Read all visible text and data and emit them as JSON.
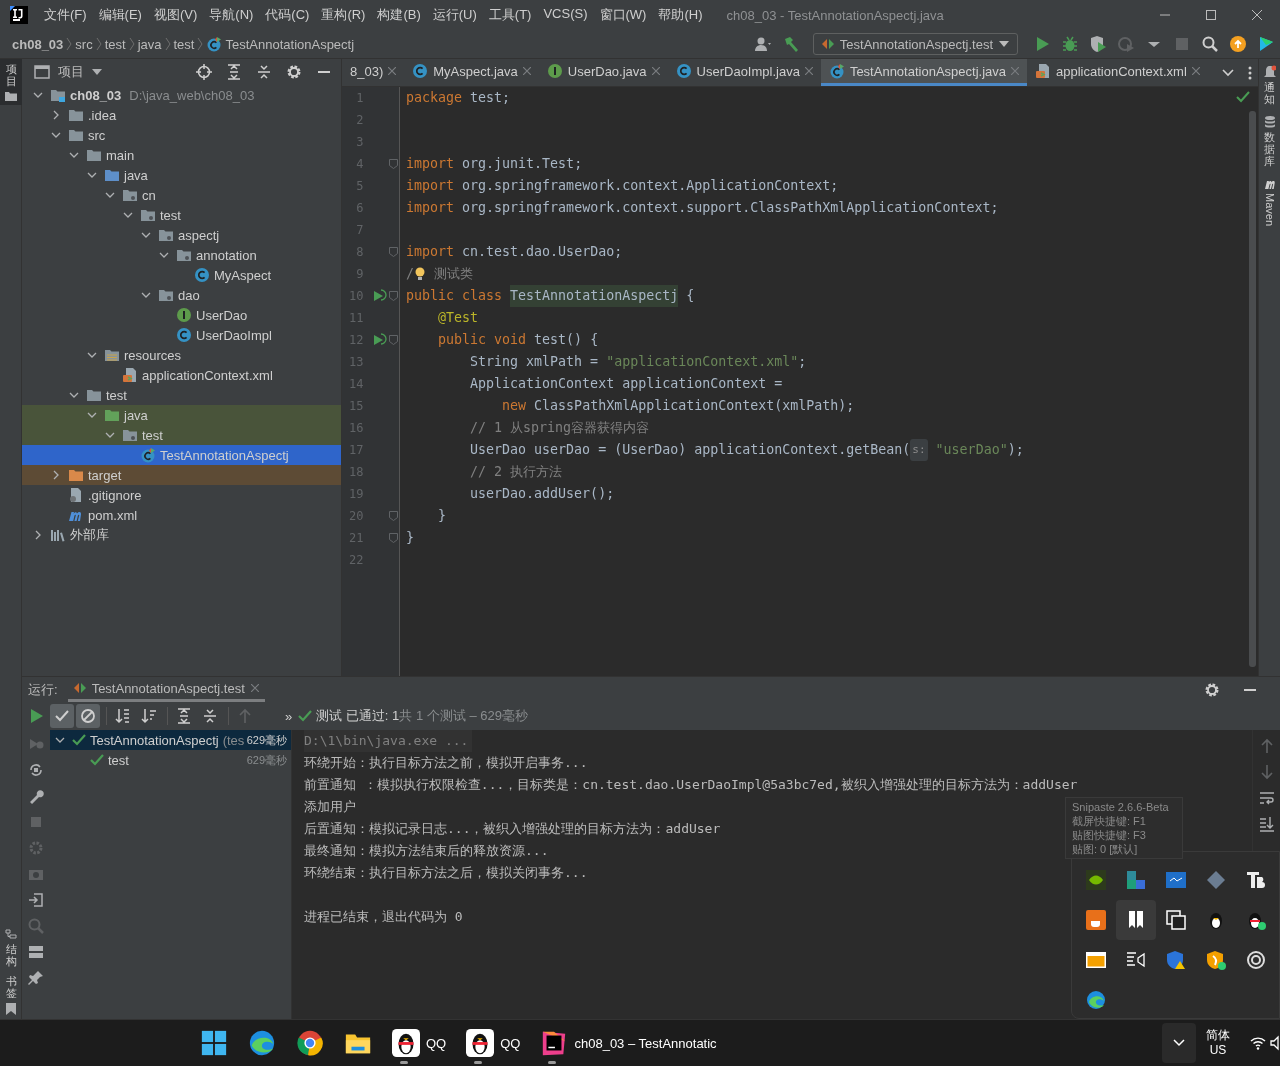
{
  "window": {
    "title": "ch08_03 - TestAnnotationAspectj.java",
    "menu": [
      "文件(F)",
      "编辑(E)",
      "视图(V)",
      "导航(N)",
      "代码(C)",
      "重构(R)",
      "构建(B)",
      "运行(U)",
      "工具(T)",
      "VCS(S)",
      "窗口(W)",
      "帮助(H)"
    ]
  },
  "breadcrumbs": [
    {
      "label": "ch08_03",
      "kind": "module"
    },
    {
      "label": "src",
      "kind": "plain"
    },
    {
      "label": "test",
      "kind": "plain"
    },
    {
      "label": "java",
      "kind": "plain"
    },
    {
      "label": "test",
      "kind": "plain"
    },
    {
      "label": "TestAnnotationAspectj",
      "kind": "class"
    }
  ],
  "run_config": {
    "label": "TestAnnotationAspectj.test"
  },
  "left_strip": {
    "top": [
      {
        "label": "项目",
        "selected": true
      }
    ],
    "bottom": [
      {
        "label": "结构",
        "selected": false
      },
      {
        "label": "书签",
        "selected": false
      }
    ]
  },
  "right_strip": [
    {
      "label": "通知",
      "kind": "bell"
    },
    {
      "label": "数据库",
      "kind": "database"
    },
    {
      "label": "Maven",
      "kind": "maven"
    }
  ],
  "project": {
    "title": "项目",
    "tree": [
      {
        "label": "ch08_03",
        "note": "D:\\java_web\\ch08_03",
        "kind": "module",
        "expanded": true,
        "selected": false,
        "children": [
          {
            "label": ".idea",
            "kind": "folder",
            "expanded": false,
            "selected": false
          },
          {
            "label": "src",
            "kind": "folder",
            "expanded": true,
            "selected": false,
            "children": [
              {
                "label": "main",
                "kind": "folder",
                "expanded": true,
                "selected": false,
                "children": [
                  {
                    "label": "java",
                    "kind": "source",
                    "expanded": true,
                    "selected": false,
                    "children": [
                      {
                        "label": "cn",
                        "kind": "package",
                        "expanded": true,
                        "selected": false,
                        "children": [
                          {
                            "label": "test",
                            "kind": "package",
                            "expanded": true,
                            "selected": false,
                            "children": [
                              {
                                "label": "aspectj",
                                "kind": "package",
                                "expanded": true,
                                "selected": false,
                                "children": [
                                  {
                                    "label": "annotation",
                                    "kind": "package",
                                    "expanded": true,
                                    "selected": false,
                                    "children": [
                                      {
                                        "label": "MyAspect",
                                        "kind": "class",
                                        "selected": false
                                      }
                                    ]
                                  }
                                ]
                              },
                              {
                                "label": "dao",
                                "kind": "package",
                                "expanded": true,
                                "selected": false,
                                "children": [
                                  {
                                    "label": "UserDao",
                                    "kind": "interface",
                                    "selected": false
                                  },
                                  {
                                    "label": "UserDaoImpl",
                                    "kind": "class",
                                    "selected": false
                                  }
                                ]
                              }
                            ]
                          }
                        ]
                      }
                    ]
                  },
                  {
                    "label": "resources",
                    "kind": "resources",
                    "expanded": true,
                    "selected": false,
                    "children": [
                      {
                        "label": "applicationContext.xml",
                        "kind": "xml",
                        "selected": false
                      }
                    ]
                  }
                ]
              },
              {
                "label": "test",
                "kind": "folder",
                "expanded": true,
                "selected": false,
                "children": [
                  {
                    "label": "java",
                    "kind": "test-source",
                    "expanded": true,
                    "selected": false,
                    "children": [
                      {
                        "label": "test",
                        "kind": "package",
                        "expanded": true,
                        "selected": false,
                        "children": [
                          {
                            "label": "TestAnnotationAspectj",
                            "kind": "test-class",
                            "selected": true
                          }
                        ]
                      }
                    ]
                  }
                ]
              }
            ]
          },
          {
            "label": "target",
            "kind": "excluded",
            "expanded": false,
            "selected": false
          },
          {
            "label": ".gitignore",
            "kind": "git",
            "selected": false
          },
          {
            "label": "pom.xml",
            "kind": "maven",
            "selected": false
          }
        ]
      },
      {
        "label": "外部库",
        "kind": "library",
        "expanded": false,
        "selected": false
      }
    ]
  },
  "editor": {
    "tabs": [
      {
        "label": "8_03)",
        "kind": "none",
        "selected": false
      },
      {
        "label": "MyAspect.java",
        "kind": "class",
        "selected": false
      },
      {
        "label": "UserDao.java",
        "kind": "interface",
        "selected": false
      },
      {
        "label": "UserDaoImpl.java",
        "kind": "class",
        "selected": false
      },
      {
        "label": "TestAnnotationAspectj.java",
        "kind": "test-class",
        "selected": true
      },
      {
        "label": "applicationContext.xml",
        "kind": "xml",
        "selected": false
      }
    ],
    "lines": [
      {
        "number": "1",
        "tokens": [
          {
            "kind": "keyword",
            "text": "package"
          },
          {
            "kind": "plain",
            "text": " test;"
          }
        ]
      },
      {
        "number": "2"
      },
      {
        "number": "3"
      },
      {
        "number": "4",
        "gutter": [
          {
            "kind": "fold"
          }
        ],
        "tokens": [
          {
            "kind": "keyword",
            "text": "import"
          },
          {
            "kind": "plain",
            "text": " org.junit.Test;"
          }
        ]
      },
      {
        "number": "5",
        "tokens": [
          {
            "kind": "keyword",
            "text": "import"
          },
          {
            "kind": "plain",
            "text": " org.springframework.context.ApplicationContext;"
          }
        ]
      },
      {
        "number": "6",
        "tokens": [
          {
            "kind": "keyword",
            "text": "import"
          },
          {
            "kind": "plain",
            "text": " org.springframework.context.support.ClassPathXmlApplicationContext;"
          }
        ]
      },
      {
        "number": "7"
      },
      {
        "number": "8",
        "gutter": [
          {
            "kind": "fold"
          }
        ],
        "tokens": [
          {
            "kind": "keyword",
            "text": "import"
          },
          {
            "kind": "plain",
            "text": " cn.test.dao.UserDao;"
          }
        ]
      },
      {
        "number": "9",
        "tokens": [
          {
            "kind": "comment",
            "text": "/"
          },
          {
            "kind": "bulb"
          },
          {
            "kind": "comment",
            "text": " 测试类"
          }
        ]
      },
      {
        "number": "10",
        "gutter": [
          {
            "kind": "run"
          },
          {
            "kind": "fold"
          }
        ],
        "tokens": [
          {
            "kind": "keyword",
            "text": "public class "
          },
          {
            "kind": "class-name",
            "text": "TestAnnotationAspectj"
          },
          {
            "kind": "plain",
            "text": " {"
          }
        ]
      },
      {
        "number": "11",
        "tokens": [
          {
            "kind": "annotation",
            "text": "    @Test"
          }
        ]
      },
      {
        "number": "12",
        "gutter": [
          {
            "kind": "run"
          },
          {
            "kind": "fold"
          }
        ],
        "tokens": [
          {
            "kind": "keyword",
            "text": "    public void "
          },
          {
            "kind": "plain",
            "text": "test() {"
          }
        ]
      },
      {
        "number": "13",
        "tokens": [
          {
            "kind": "plain",
            "text": "        String xmlPath = "
          },
          {
            "kind": "string",
            "text": "\"applicationContext.xml\""
          },
          {
            "kind": "plain",
            "text": ";"
          }
        ]
      },
      {
        "number": "14",
        "tokens": [
          {
            "kind": "plain",
            "text": "        ApplicationContext applicationContext ="
          }
        ]
      },
      {
        "number": "15",
        "tokens": [
          {
            "kind": "keyword",
            "text": "            new "
          },
          {
            "kind": "plain",
            "text": "ClassPathXmlApplicationContext(xmlPath);"
          }
        ]
      },
      {
        "number": "16",
        "tokens": [
          {
            "kind": "comment",
            "text": "        // 1 从spring容器获得内容"
          }
        ]
      },
      {
        "number": "17",
        "tokens": [
          {
            "kind": "plain",
            "text": "        UserDao userDao = (UserDao) applicationContext.getBean("
          },
          {
            "kind": "hint",
            "text": "s:"
          },
          {
            "kind": "string",
            "text": " \"userDao\""
          },
          {
            "kind": "plain",
            "text": ");"
          }
        ]
      },
      {
        "number": "18",
        "tokens": [
          {
            "kind": "comment",
            "text": "        // 2 执行方法"
          }
        ]
      },
      {
        "number": "19",
        "tokens": [
          {
            "kind": "plain",
            "text": "        userDao.addUser();"
          }
        ]
      },
      {
        "number": "20",
        "gutter": [
          {
            "kind": "fold"
          }
        ],
        "tokens": [
          {
            "kind": "plain",
            "text": "    }"
          }
        ]
      },
      {
        "number": "21",
        "gutter": [
          {
            "kind": "fold"
          }
        ],
        "tokens": [
          {
            "kind": "plain",
            "text": "}"
          }
        ]
      },
      {
        "number": "22"
      }
    ]
  },
  "run_panel": {
    "label": "运行:",
    "tab": "TestAnnotationAspectj.test",
    "toolbar": [
      {
        "kind": "passed",
        "on": true
      },
      {
        "kind": "ignored",
        "on": true
      },
      {
        "kind": "sort-alpha",
        "on": false
      },
      {
        "kind": "sort-time",
        "on": false
      },
      {
        "kind": "expand",
        "on": false
      },
      {
        "kind": "collapse",
        "on": false
      },
      {
        "kind": "up",
        "on": false
      }
    ],
    "more": "»",
    "status": "测试 已通过: 1",
    "summary": "共 1 个测试 – 629毫秒",
    "tests": [
      {
        "label": "TestAnnotationAspectj",
        "detail": "(tes",
        "time": "629毫秒",
        "expanded": true,
        "selected": true,
        "children": [
          {
            "label": "test",
            "time": "629毫秒",
            "selected": false
          }
        ]
      }
    ],
    "console": [
      {
        "kind": "command",
        "text": "D:\\1\\bin\\java.exe ..."
      },
      {
        "kind": "output",
        "text": "环绕开始：执行目标方法之前，模拟开启事务..."
      },
      {
        "kind": "output",
        "text": "前置通知 ：模拟执行权限检查...，目标类是：cn.test.dao.UserDaoImpl@5a3bc7ed,被织入增强处理的目标方法为：addUser"
      },
      {
        "kind": "output",
        "text": "添加用户"
      },
      {
        "kind": "output",
        "text": "后置通知：模拟记录日志...，被织入增强处理的目标方法为：addUser"
      },
      {
        "kind": "output",
        "text": "最终通知：模拟方法结束后的释放资源..."
      },
      {
        "kind": "output",
        "text": "环绕结束：执行目标方法之后，模拟关闭事务..."
      },
      {
        "kind": "exit",
        "text": "进程已结束，退出代码为 0"
      }
    ]
  },
  "snipaste_tooltip": {
    "lines": [
      "Snipaste 2.6.6-Beta",
      "截屏快捷键: F1",
      "贴图快捷键: F3",
      "贴图: 0 [默认]"
    ]
  },
  "tray_popup": {
    "icons": [
      {
        "kind": "gpu",
        "selected": false
      },
      {
        "kind": "puzzle",
        "selected": false
      },
      {
        "kind": "monitor",
        "selected": false
      },
      {
        "kind": "diamond",
        "selected": false
      },
      {
        "kind": "typeface",
        "selected": false
      },
      {
        "kind": "cup",
        "selected": false
      },
      {
        "kind": "bookmark",
        "selected": true
      },
      {
        "kind": "windows",
        "selected": false
      },
      {
        "kind": "penguin",
        "selected": false
      },
      {
        "kind": "penguin-badge",
        "selected": false
      },
      {
        "kind": "window",
        "selected": false
      },
      {
        "kind": "speaker-list",
        "selected": false
      },
      {
        "kind": "shield-warning",
        "selected": false
      },
      {
        "kind": "shield-badge",
        "selected": false
      },
      {
        "kind": "target",
        "selected": false
      },
      {
        "kind": "browser",
        "selected": false
      }
    ]
  },
  "taskbar": {
    "apps": [
      {
        "kind": "start",
        "running": false
      },
      {
        "kind": "browser",
        "running": false
      },
      {
        "kind": "chrome",
        "running": false
      },
      {
        "kind": "files",
        "running": false
      },
      {
        "kind": "penguin",
        "label": "QQ",
        "running": true
      },
      {
        "kind": "penguin",
        "label": "QQ",
        "running": true
      },
      {
        "kind": "ide",
        "label": "ch08_03 – TestAnnotatic",
        "running": true
      }
    ],
    "ime": {
      "language": "简体",
      "layout": "US"
    }
  }
}
